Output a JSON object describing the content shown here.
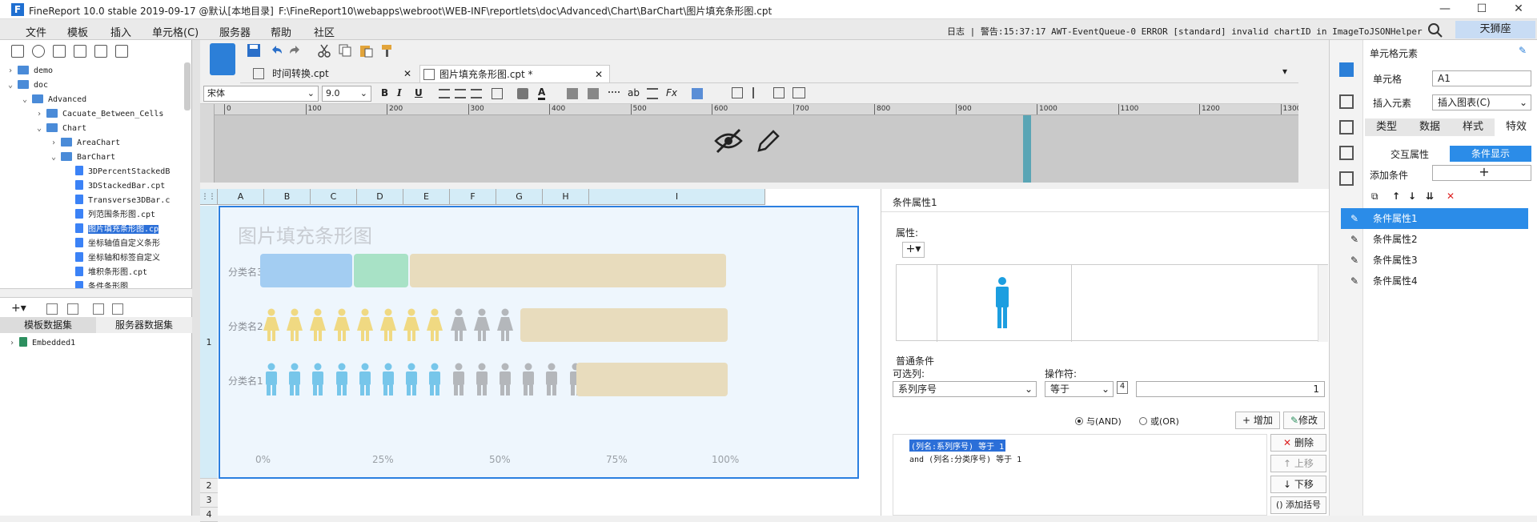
{
  "app": {
    "title": "FineReport 10.0 stable 2019-09-17 @默认[本地目录]",
    "path": "F:\\FineReport10\\webapps\\webroot\\WEB-INF\\reportlets\\doc\\Advanced\\Chart\\BarChart\\图片填充条形图.cpt",
    "logo": "F"
  },
  "menu": [
    "文件",
    "模板",
    "插入",
    "单元格(C)",
    "服务器",
    "帮助",
    "社区"
  ],
  "log_text": "日志 | 警告:15:37:17 AWT-EventQueue-0 ERROR [standard] invalid chartID in ImageToJSONHelper",
  "user": "天狮座",
  "tree": [
    {
      "label": "demo",
      "type": "folder",
      "level": 0,
      "arrow": "›"
    },
    {
      "label": "doc",
      "type": "folder",
      "level": 0,
      "arrow": "⌄"
    },
    {
      "label": "Advanced",
      "type": "folder",
      "level": 1,
      "arrow": "⌄"
    },
    {
      "label": "Cacuate_Between_Cells",
      "type": "folder",
      "level": 2,
      "arrow": "›"
    },
    {
      "label": "Chart",
      "type": "folder",
      "level": 2,
      "arrow": "⌄"
    },
    {
      "label": "AreaChart",
      "type": "folder",
      "level": 3,
      "arrow": "›"
    },
    {
      "label": "BarChart",
      "type": "folder",
      "level": 3,
      "arrow": "⌄"
    },
    {
      "label": "3DPercentStackedB",
      "type": "file",
      "level": 4
    },
    {
      "label": "3DStackedBar.cpt",
      "type": "file",
      "level": 4
    },
    {
      "label": "Transverse3DBar.c",
      "type": "file",
      "level": 4
    },
    {
      "label": "列范围条形图.cpt",
      "type": "file",
      "level": 4
    },
    {
      "label": "图片填充条形图.cp",
      "type": "file",
      "level": 4,
      "selected": true
    },
    {
      "label": "坐标轴值自定义条形",
      "type": "file",
      "level": 4
    },
    {
      "label": "坐标轴和标签自定义",
      "type": "file",
      "level": 4
    },
    {
      "label": "堆积条形图.cpt",
      "type": "file",
      "level": 4
    },
    {
      "label": "条件条形图",
      "type": "file",
      "level": 4
    }
  ],
  "dataset_tabs": [
    "模板数据集",
    "服务器数据集"
  ],
  "dataset_tree": [
    "Embedded1"
  ],
  "doc_tabs": [
    {
      "label": "时间转换.cpt",
      "active": false
    },
    {
      "label": "图片填充条形图.cpt *",
      "active": true
    }
  ],
  "font": {
    "name": "宋体",
    "size": "9.0"
  },
  "format_buttons": [
    "B",
    "I",
    "U"
  ],
  "ruler": [
    "0",
    "100",
    "200",
    "300",
    "400",
    "500",
    "600",
    "700",
    "800",
    "900",
    "1000",
    "1100",
    "1200",
    "1300"
  ],
  "columns": [
    "A",
    "B",
    "C",
    "D",
    "E",
    "F",
    "G",
    "H",
    "I"
  ],
  "rows": [
    "1",
    "2",
    "3",
    "4"
  ],
  "chart_data": {
    "type": "bar",
    "title": "图片填充条形图",
    "categories": [
      "分类名3",
      "分类名2",
      "分类名1"
    ],
    "orientation": "horizontal",
    "series": [
      {
        "values": [
          20,
          55,
          50
        ]
      },
      {
        "values": [
          12,
          0,
          0
        ]
      },
      {
        "values": [
          68,
          45,
          50
        ]
      }
    ],
    "percent_stack": [
      {
        "segments": [
          20,
          12,
          68
        ]
      },
      {
        "segments": [
          55,
          45
        ]
      },
      {
        "segments": [
          50,
          50
        ]
      }
    ],
    "x_ticks": [
      "0%",
      "25%",
      "50%",
      "75%",
      "100%"
    ],
    "xlim": [
      0,
      100
    ],
    "colors": {
      "bar_blue": "#a3cdf2",
      "bar_green": "#a8e2c6",
      "bar_beige": "#e8dcbd",
      "person_yellow": "#f0d982",
      "person_blue": "#77c6ea",
      "person_gray": "#b4b7bb"
    }
  },
  "cond_panel": {
    "header": "条件属性1",
    "property_label": "属性:",
    "normal_cond": "普通条件",
    "selectable_col": "可选列:",
    "operator": "操作符:",
    "col_value": "系列序号",
    "op_value": "等于",
    "num_value": "1",
    "and_label": "与(AND)",
    "or_label": "或(OR)",
    "add": "增加",
    "modify": "修改",
    "delete": "删除",
    "up": "上移",
    "down": "下移",
    "add_paren": "添加括号",
    "conditions": [
      "(列名:系列序号) 等于 1",
      "and (列名:分类序号) 等于 1"
    ]
  },
  "right_panel": {
    "title": "单元格元素",
    "cell_label": "单元格",
    "cell_value": "A1",
    "insert_label": "插入元素",
    "insert_value": "插入图表(C)",
    "tabs": [
      "类型",
      "数据",
      "样式",
      "特效"
    ],
    "subtabs": [
      "交互属性",
      "条件显示"
    ],
    "add_cond": "添加条件",
    "add_plus": "+",
    "items": [
      "条件属性1",
      "条件属性2",
      "条件属性3",
      "条件属性4"
    ]
  }
}
